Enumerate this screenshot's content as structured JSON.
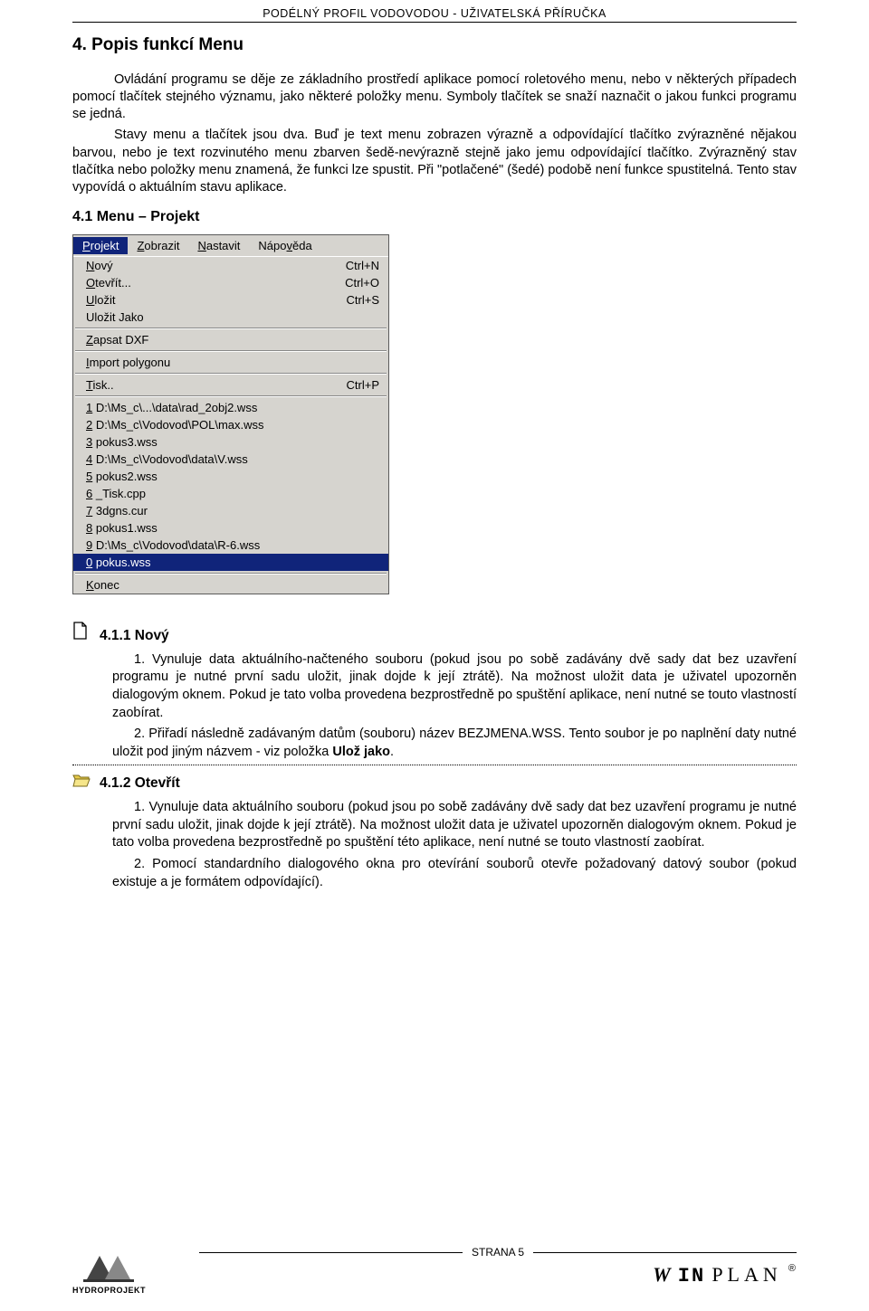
{
  "header": {
    "title": "PODÉLNÝ PROFIL VODOVODOU  -  UŽIVATELSKÁ PŘÍRUČKA"
  },
  "section4": {
    "title": "4. Popis funkcí Menu",
    "para": "Ovládání programu se děje ze základního prostředí aplikace pomocí roletového menu, nebo v některých případech pomocí tlačítek stejného významu, jako některé položky menu. Symboly tlačítek se snaží naznačit o jakou funkci programu se jedná.",
    "para2": "Stavy menu a tlačítek jsou dva. Buď je text menu zobrazen výrazně a odpovídající tlačítko zvýrazněné nějakou barvou, nebo je text rozvinutého menu zbarven šedě-nevýrazně stejně jako jemu odpovídající tlačítko. Zvýrazněný stav tlačítka nebo položky menu znamená, že funkci lze spustit. Při \"potlačené\" (šedé) podobě není funkce spustitelná. Tento stav vypovídá o aktuálním stavu aplikace."
  },
  "section41": {
    "title": "4.1 Menu – Projekt"
  },
  "menu": {
    "bar": [
      "Projekt",
      "Zobrazit",
      "Nastavit",
      "Nápověda"
    ],
    "items": [
      {
        "label": "Nový",
        "ul": "N",
        "short": "Ctrl+N"
      },
      {
        "label": "Otevřít...",
        "ul": "O",
        "short": "Ctrl+O"
      },
      {
        "label": "Uložit",
        "ul": "U",
        "short": "Ctrl+S"
      },
      {
        "label": "Uložit Jako",
        "ul": "",
        "short": ""
      }
    ],
    "group2": [
      {
        "label": "Zapsat DXF",
        "ul": "Z",
        "short": ""
      }
    ],
    "group3": [
      {
        "label": "Import polygonu",
        "ul": "I",
        "short": ""
      }
    ],
    "group4": [
      {
        "label": "Tisk..",
        "ul": "T",
        "short": "Ctrl+P"
      }
    ],
    "recent": [
      "1 D:\\Ms_c\\...\\data\\rad_2obj2.wss",
      "2 D:\\Ms_c\\Vodovod\\POL\\max.wss",
      "3 pokus3.wss",
      "4 D:\\Ms_c\\Vodovod\\data\\V.wss",
      "5 pokus2.wss",
      "6 _Tisk.cpp",
      "7 3dgns.cur",
      "8 pokus1.wss",
      "9 D:\\Ms_c\\Vodovod\\data\\R-6.wss",
      "0 pokus.wss"
    ],
    "konec": "Konec"
  },
  "section411": {
    "title": "4.1.1 Nový",
    "p1": "1. Vynuluje data aktuálního-načteného souboru (pokud jsou po sobě zadávány dvě sady dat bez uzavření programu je nutné první sadu uložit, jinak dojde k její ztrátě). Na možnost uložit data je uživatel upozorněn dialogovým oknem. Pokud je tato volba provedena bezprostředně po spuštění aplikace, není nutné se touto vlastností zaobírat.",
    "p2a": "2. Přiřadí následně zadávaným datům (souboru) název BEZJMENA.WSS. Tento soubor je po naplnění daty nutné uložit pod jiným názvem - viz položka ",
    "p2b": "Ulož jako",
    "p2c": "."
  },
  "section412": {
    "title": "4.1.2 Otevřít",
    "p1": "1. Vynuluje data aktuálního souboru (pokud jsou po sobě zadávány dvě sady dat bez uzavření programu je nutné první sadu uložit, jinak dojde k její ztrátě).  Na možnost uložit data je uživatel upozorněn dialogovým oknem. Pokud je tato volba provedena bezprostředně po spuštění této aplikace, není nutné se touto  vlastností zaobírat.",
    "p2": "2. Pomocí standardního dialogového okna pro otevírání souborů otevře požadovaný datový soubor (pokud existuje a je formátem odpovídající)."
  },
  "footer": {
    "page": "STRANA 5",
    "logo_text": "HYDROPROJEKT",
    "brand_w": "W",
    "brand_in": "IN",
    "brand_plan": "PLAN",
    "reg": "®"
  }
}
